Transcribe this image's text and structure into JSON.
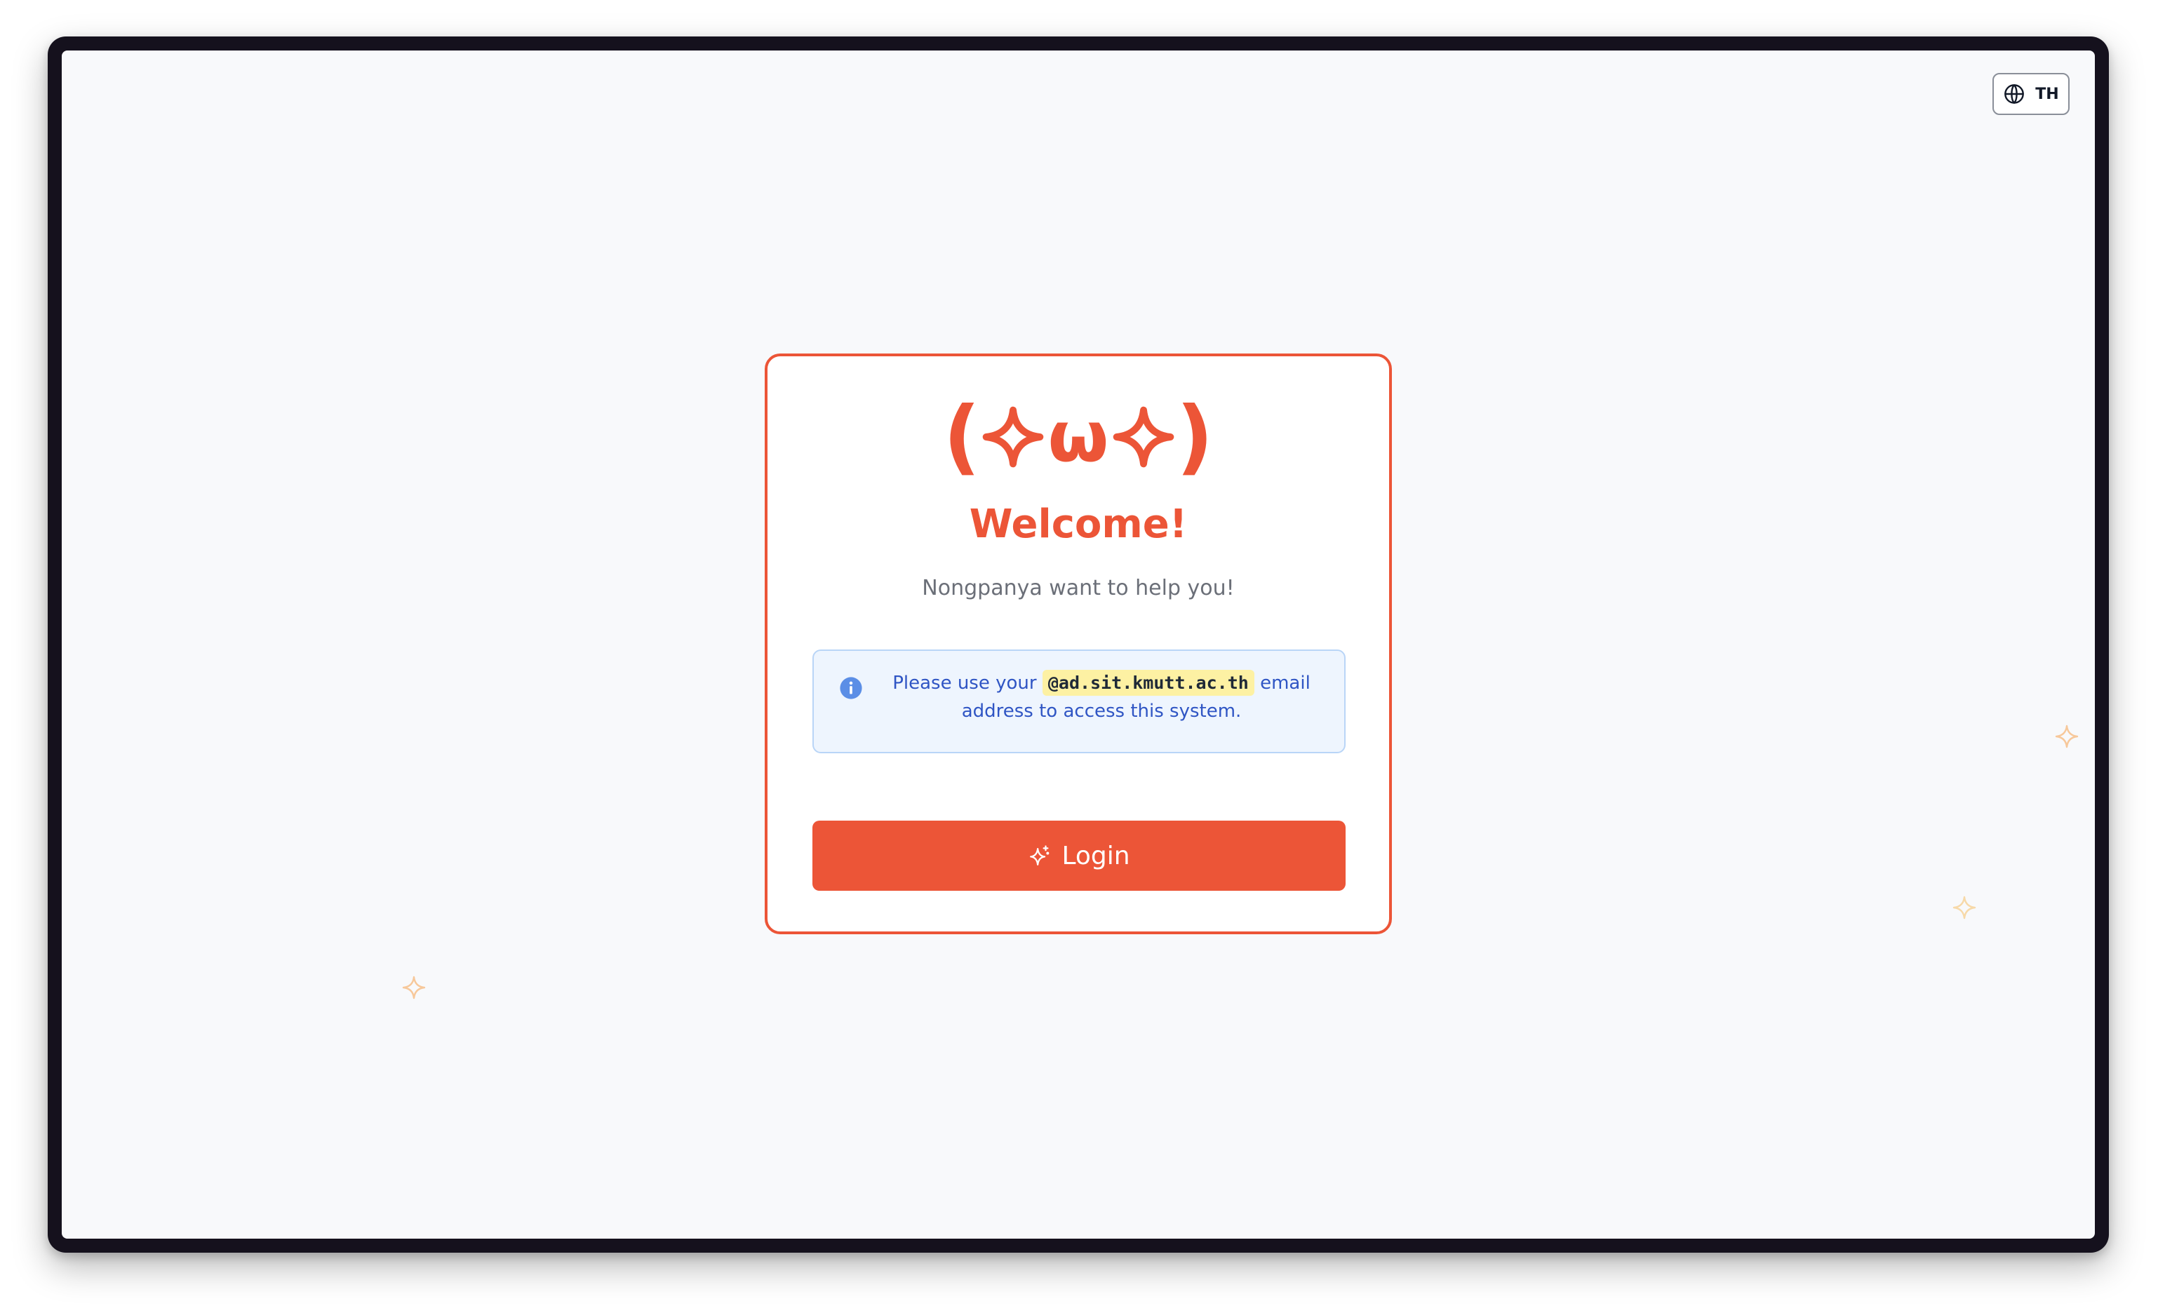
{
  "header": {
    "language_button_label": "TH",
    "language_icon": "globe-icon"
  },
  "card": {
    "kaomoji": {
      "left_paren": "(",
      "mouth": "ω",
      "right_paren": ")",
      "eye_icon": "four-point-star-outline"
    },
    "title": "Welcome!",
    "subtitle": "Nongpanya want to help you!",
    "notice": {
      "icon": "info-icon",
      "text_before": "Please use your",
      "domain": "@ad.sit.kmutt.ac.th",
      "text_after": "email address to access this system."
    },
    "login_button": {
      "label": "Login",
      "icon": "sparkles-icon"
    }
  },
  "decorations": {
    "icon": "sparkle-icon",
    "color": "#f7c89a"
  },
  "colors": {
    "accent": "#ec5537",
    "info_background": "#eef5fe",
    "info_border": "#b9d5f7",
    "info_text": "#2f55c4",
    "highlight": "#fdf1a3",
    "page_background": "#f8f9fb"
  }
}
